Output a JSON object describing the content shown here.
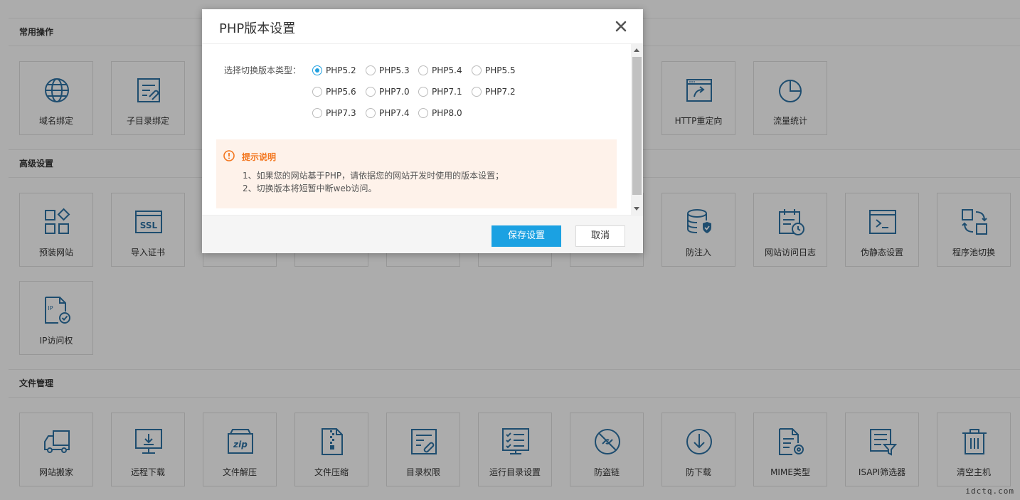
{
  "sections": {
    "common": "常用操作",
    "advanced": "高级设置",
    "files": "文件管理"
  },
  "tiles": {
    "domain": "域名绑定",
    "subdir": "子目录绑定",
    "redirect": "HTTP重定向",
    "traffic": "流量统计",
    "preinstall": "预装网站",
    "ssl": "导入证书",
    "anti_inject": "防注入",
    "access_log": "网站访问日志",
    "rewrite": "伪静态设置",
    "pool": "程序池切换",
    "ip_access": "IP访问权",
    "migrate": "网站搬家",
    "remote_download": "远程下载",
    "unzip": "文件解压",
    "zip": "文件压缩",
    "dir_perm": "目录权限",
    "run_dir": "运行目录设置",
    "hotlink": "防盗链",
    "anti_download": "防下载",
    "mime": "MIME类型",
    "isapi": "ISAPI筛选器",
    "clear_host": "清空主机"
  },
  "icons": {
    "domain": "globe-icon",
    "subdir": "subdirectory-icon",
    "redirect": "redirect-window-icon",
    "traffic": "pie-chart-icon",
    "preinstall": "grid-diamond-icon",
    "ssl": "ssl-certificate-icon",
    "anti_inject": "database-shield-icon",
    "access_log": "calendar-clock-icon",
    "rewrite": "terminal-icon",
    "pool": "swap-squares-icon",
    "ip_access": "ip-document-check-icon",
    "migrate": "truck-icon",
    "remote_download": "monitor-download-icon",
    "unzip": "zip-box-icon",
    "zip": "zip-file-icon",
    "dir_perm": "document-link-icon",
    "run_dir": "checklist-monitor-icon",
    "hotlink": "no-link-icon",
    "anti_download": "download-circle-icon",
    "mime": "document-gear-icon",
    "isapi": "filter-list-icon",
    "clear_host": "trash-icon"
  },
  "dialog": {
    "title": "PHP版本设置",
    "version_label": "选择切换版本类型：",
    "versions": [
      "PHP5.2",
      "PHP5.3",
      "PHP5.4",
      "PHP5.5",
      "PHP5.6",
      "PHP7.0",
      "PHP7.1",
      "PHP7.2",
      "PHP7.3",
      "PHP7.4",
      "PHP8.0"
    ],
    "selected": "PHP5.2",
    "tip_title": "提示说明",
    "tip_lines": [
      "1、如果您的网站基于PHP，请依据您的网站开发时使用的版本设置；",
      "2、切换版本将短暂中断web访问。"
    ],
    "save": "保存设置",
    "cancel": "取消"
  },
  "colors": {
    "accent": "#1ba1e2",
    "icon": "#2c6fa0",
    "tip_background": "#fef2ea",
    "tip_title": "#f3761e"
  },
  "watermark": "idctq.com"
}
